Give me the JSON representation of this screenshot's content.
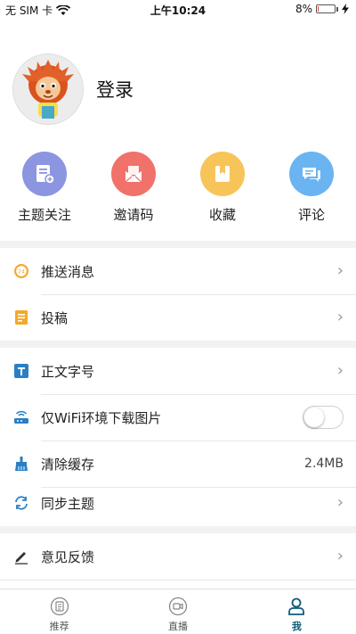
{
  "status_bar": {
    "carrier": "无 SIM 卡",
    "time": "上午10:24",
    "battery_percent_text": "8%",
    "battery_level": 0.08,
    "battery_color": "#e53935"
  },
  "profile": {
    "login_label": "登录",
    "avatar_icon": "lion-mascot-avatar"
  },
  "quick_actions": [
    {
      "label": "主题关注",
      "icon": "topic-follow-icon",
      "color": "#8b95e0"
    },
    {
      "label": "邀请码",
      "icon": "invite-envelope-icon",
      "color": "#f0726a"
    },
    {
      "label": "收藏",
      "icon": "bookmark-icon",
      "color": "#f7c45a"
    },
    {
      "label": "评论",
      "icon": "comment-icon",
      "color": "#6ab4f2"
    }
  ],
  "menu": {
    "push": {
      "label": "推送消息",
      "icon": "clock-24-icon"
    },
    "contribute": {
      "label": "投稿",
      "icon": "notebook-icon"
    },
    "font_size": {
      "label": "正文字号",
      "icon": "text-t-icon"
    },
    "wifi_only": {
      "label": "仅WiFi环境下载图片",
      "icon": "router-icon",
      "enabled": false
    },
    "clear_cache": {
      "label": "清除缓存",
      "icon": "broom-icon",
      "value": "2.4MB"
    },
    "sync_topics": {
      "label": "同步主题",
      "icon": "sync-icon"
    },
    "feedback": {
      "label": "意见反馈",
      "icon": "pencil-icon"
    }
  },
  "tabbar": {
    "tabs": [
      {
        "label": "推荐",
        "icon": "recommend-icon",
        "active": false
      },
      {
        "label": "直播",
        "icon": "live-camera-icon",
        "active": false
      },
      {
        "label": "我",
        "icon": "person-icon",
        "active": true
      }
    ],
    "active_color": "#0d5c7a"
  }
}
